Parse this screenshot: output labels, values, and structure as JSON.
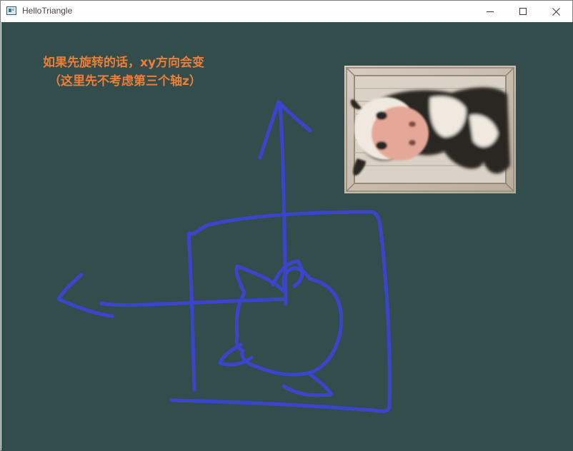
{
  "window": {
    "title": "HelloTriangle",
    "controls": {
      "minimize": "minimize-icon",
      "maximize": "maximize-icon",
      "close": "close-icon"
    }
  },
  "viewport": {
    "clear_color": "#334d4d"
  },
  "annotation": {
    "line1": "如果先旋转的话，xy方向会变",
    "line2": "（这里先不考虑第三个轴z）",
    "color": "#ee7e35"
  },
  "sketch": {
    "stroke_color": "#3d44cc"
  },
  "texture": {
    "description_icon": "container-cow-texture"
  }
}
